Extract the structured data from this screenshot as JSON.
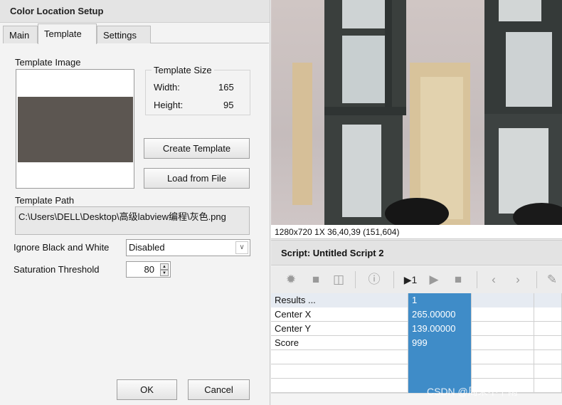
{
  "dialog": {
    "title": "Color Location Setup",
    "tabs": [
      "Main",
      "Template",
      "Settings"
    ],
    "active_tab": "Template",
    "template_image_label": "Template Image",
    "template_size": {
      "title": "Template Size",
      "width_label": "Width:",
      "width_value": "165",
      "height_label": "Height:",
      "height_value": "95"
    },
    "create_template_button": "Create Template",
    "load_from_file_button": "Load from File",
    "template_path_label": "Template Path",
    "template_path_value": "C:\\Users\\DELL\\Desktop\\高级labview编程\\灰色.png",
    "ignore_bw_label": "Ignore Black and White",
    "ignore_bw_value": "Disabled",
    "saturation_label": "Saturation Threshold",
    "saturation_value": "80",
    "ok_button": "OK",
    "cancel_button": "Cancel"
  },
  "camera": {
    "status": "1280x720 1X 36,40,39   (151,604)"
  },
  "script": {
    "title": "Script: Untitled Script 2",
    "toolbar": [
      "new-icon",
      "open-folder-icon",
      "save-icon",
      "info-icon",
      "run-once-icon",
      "run-icon",
      "stop-icon",
      "step-back-icon",
      "step-forward-icon",
      "edit-icon"
    ],
    "run_once_label": "▶1",
    "results": {
      "header": [
        "Results ...",
        "1",
        "",
        ""
      ],
      "rows": [
        [
          "Center X",
          "265.00000",
          "",
          ""
        ],
        [
          "Center Y",
          "139.00000",
          "",
          ""
        ],
        [
          "Score",
          "999",
          "",
          ""
        ],
        [
          "",
          "",
          "",
          ""
        ],
        [
          "",
          "",
          "",
          ""
        ],
        [
          "",
          "",
          "",
          ""
        ]
      ]
    }
  },
  "watermark": "CSDN @周末不下雨"
}
